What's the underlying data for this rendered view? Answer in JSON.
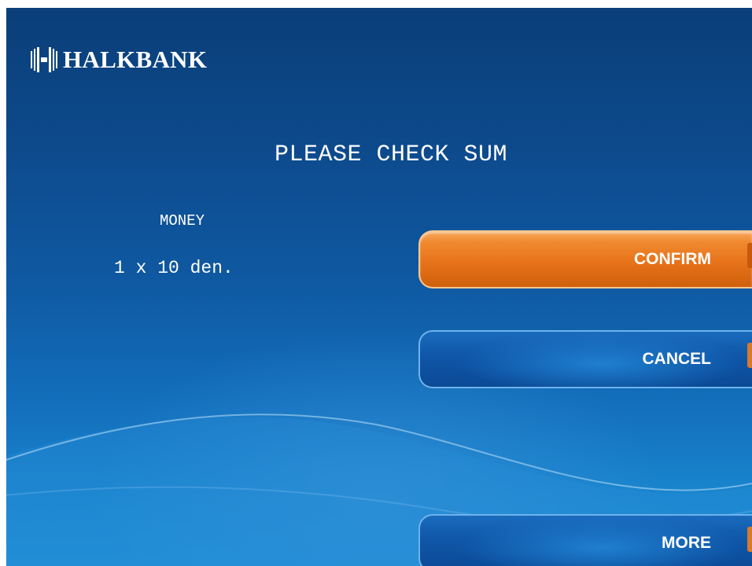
{
  "brand": {
    "name": "HALKBANK",
    "logo_icon": "halkbank-logo-icon"
  },
  "screen": {
    "title": "PLEASE CHECK SUM"
  },
  "summary": {
    "label": "MONEY",
    "value": "1 x 10 den."
  },
  "buttons": {
    "confirm": "CONFIRM",
    "cancel": "CANCEL",
    "more": "MORE"
  },
  "colors": {
    "background_top": "#0a3f79",
    "background_bottom": "#1e8fd6",
    "confirm_button": "#e7731a",
    "secondary_button": "#0f56a8",
    "text": "#ffffff"
  }
}
